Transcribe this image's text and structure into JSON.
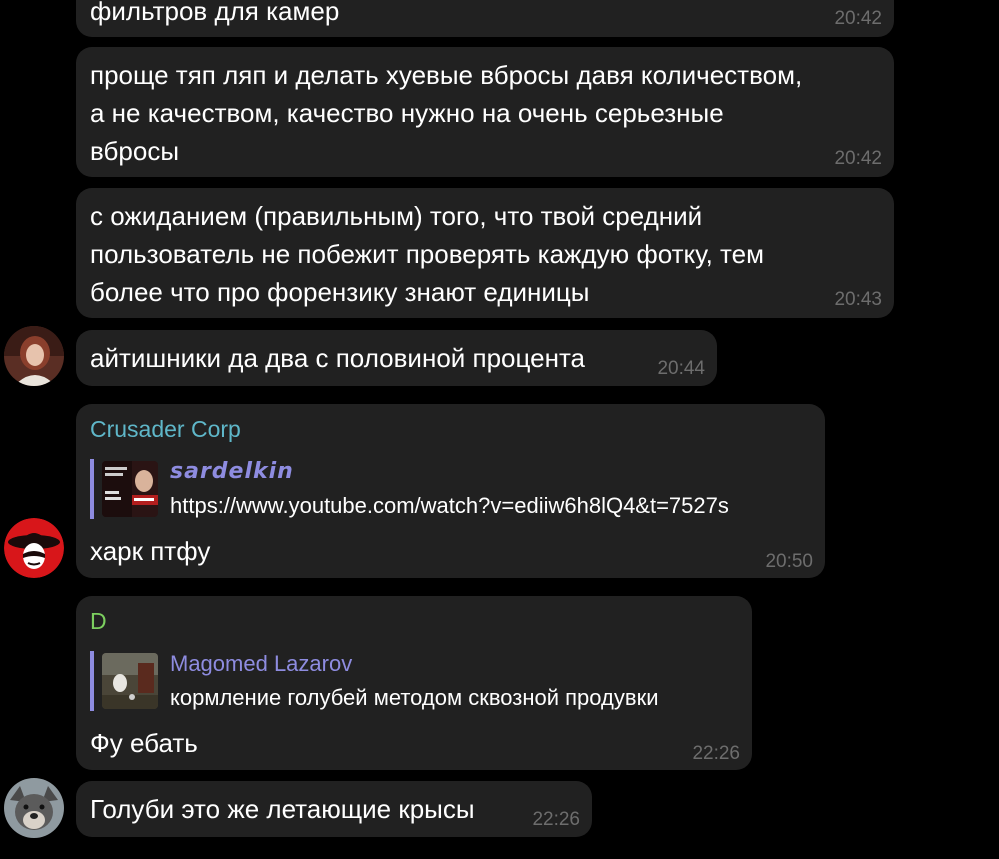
{
  "messages": [
    {
      "text": "фильтров для камер",
      "time": "20:42"
    },
    {
      "text": "проще тяп ляп и делать хуевые вбросы давя количеством,\nа не качеством, качество нужно на очень серьезные\nвбросы",
      "time": "20:42"
    },
    {
      "text": "с ожиданием (правильным) того, что твой средний\nпользователь не побежит проверять каждую фотку, тем\nболее что про форензику знают единицы",
      "time": "20:43"
    },
    {
      "text": "айтишники да два с половиной процента",
      "time": "20:44"
    },
    {
      "sender": "Crusader Corp",
      "reply": {
        "author": "sardelkin",
        "text": "https://www.youtube.com/watch?v=ediiw6h8lQ4&t=7527s"
      },
      "text": "харк птфу",
      "time": "20:50"
    },
    {
      "sender": "D",
      "reply": {
        "author": "Magomed Lazarov",
        "text": "кормление голубей методом сквозной продувки"
      },
      "text": "Фу ебать",
      "time": "22:26"
    },
    {
      "text": "Голуби это же летающие крысы",
      "time": "22:26"
    }
  ],
  "colors": {
    "background": "#000000",
    "bubble": "#212121",
    "sender_crusader": "#5fb7c9",
    "sender_d": "#7ccf5f",
    "reply_accent": "#8e8ce0",
    "timestamp": "#6d6d6d"
  }
}
